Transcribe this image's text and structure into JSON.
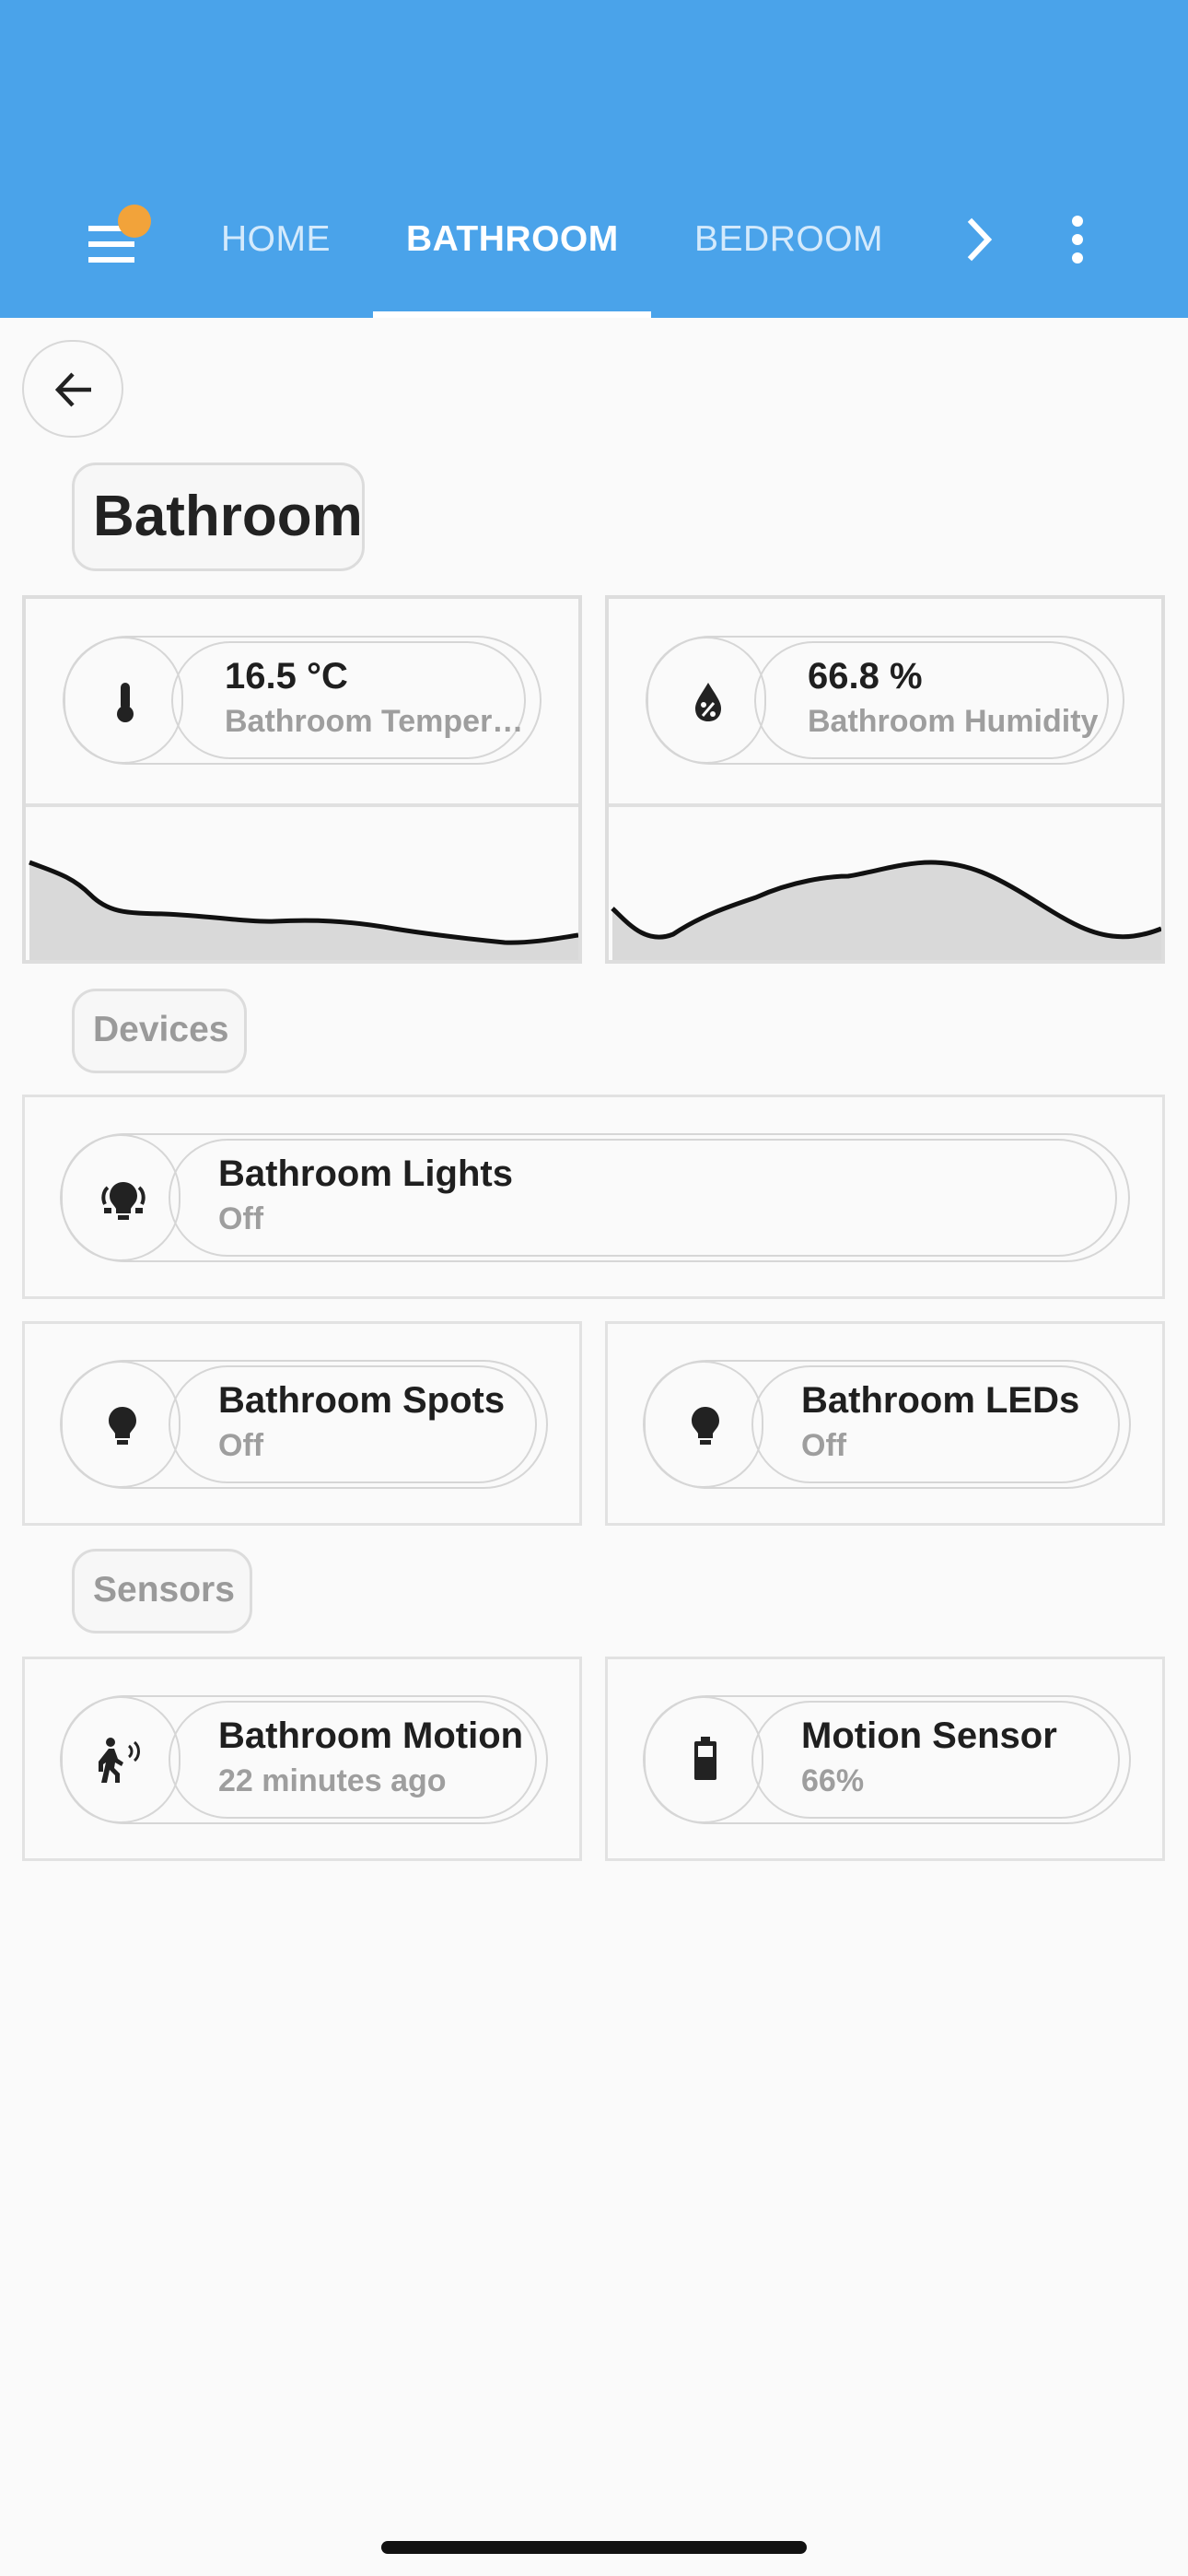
{
  "tabs": [
    {
      "label": "HOME",
      "active": false
    },
    {
      "label": "BATHROOM",
      "active": true
    },
    {
      "label": "BEDROOM",
      "active": false
    }
  ],
  "page_title": "Bathroom",
  "sensors_top": [
    {
      "value": "16.5 °C",
      "name": "Bathroom Tempera…",
      "icon": "thermometer-icon"
    },
    {
      "value": "66.8 %",
      "name": "Bathroom Humidity",
      "icon": "water-percent-icon"
    }
  ],
  "sections": {
    "devices": "Devices",
    "sensors": "Sensors"
  },
  "devices": [
    {
      "name": "Bathroom Lights",
      "state": "Off",
      "icon": "lightbulb-group-icon"
    },
    {
      "name": "Bathroom Spots",
      "state": "Off",
      "icon": "lightbulb-icon"
    },
    {
      "name": "Bathroom LEDs",
      "state": "Off",
      "icon": "lightbulb-icon"
    }
  ],
  "sensors": [
    {
      "name": "Bathroom Motion",
      "state": "22 minutes ago",
      "icon": "motion-sensor-icon"
    },
    {
      "name": "Motion Sensor",
      "state": "66%",
      "icon": "battery-icon"
    }
  ],
  "colors": {
    "header": "#4aa3ea",
    "badge": "#f2a33a",
    "graph_fill": "#d9d9d9",
    "graph_line": "#111111"
  }
}
